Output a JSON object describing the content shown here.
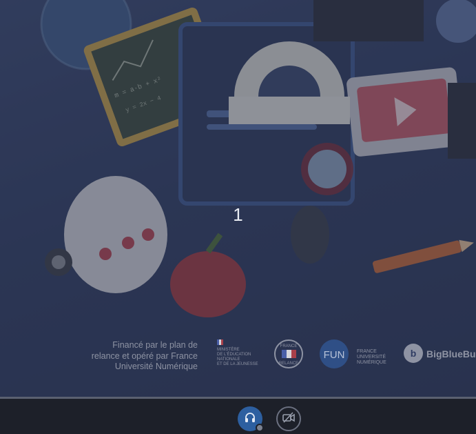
{
  "countdown": {
    "value": "1"
  },
  "footer": {
    "funding_lines": [
      "Financé par le plan de",
      "relance et opéré par France",
      "Université Numérique"
    ],
    "logos": {
      "ministere": [
        "MINISTÈRE",
        "DE L'ÉDUCATION",
        "NATIONALE",
        "ET DE LA JEUNESSE"
      ],
      "france_relance": [
        "FRANCE",
        "RELANCE"
      ],
      "fun_badge": "FUN",
      "fun_text": [
        "FRANCE",
        "UNIVERSITÉ",
        "NUMÉRIQUE"
      ],
      "bbb": "BigBlueBu"
    }
  },
  "controls": {
    "audio": {
      "icon": "headphones-icon",
      "active": true
    },
    "video": {
      "icon": "video-off-icon",
      "active": false
    }
  },
  "colors": {
    "background": "#2f3c63",
    "controlbar": "#1d2029",
    "audio_active": "#2d5fa0"
  }
}
